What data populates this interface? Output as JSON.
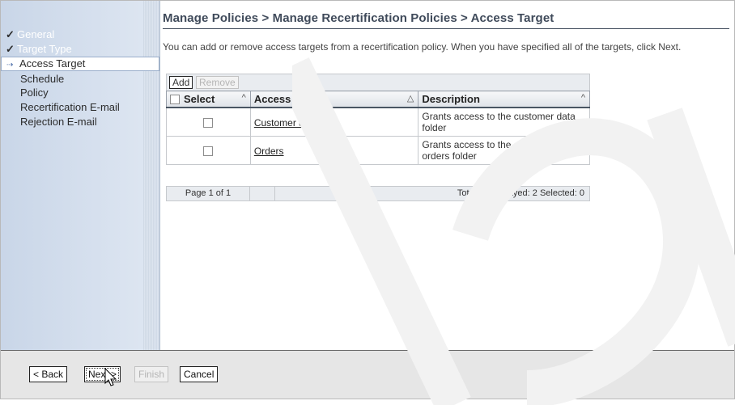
{
  "sidebar": {
    "items": [
      {
        "label": "General",
        "state": "done"
      },
      {
        "label": "Target Type",
        "state": "done"
      },
      {
        "label": "Access Target",
        "state": "current"
      },
      {
        "label": "Schedule",
        "state": "todo"
      },
      {
        "label": "Policy",
        "state": "todo"
      },
      {
        "label": "Recertification E-mail",
        "state": "todo"
      },
      {
        "label": "Rejection E-mail",
        "state": "todo"
      }
    ]
  },
  "main": {
    "title": "Manage Policies > Manage Recertification Policies > Access Target",
    "instructions": "You can add or remove access targets from a recertification policy. When you have specified all of the targets, click Next."
  },
  "toolbar": {
    "add_label": "Add",
    "remove_label": "Remove"
  },
  "table": {
    "columns": [
      "Select",
      "Access Name",
      "Description"
    ],
    "rows": [
      {
        "name": "Customer data",
        "description": "Grants access to the customer data folder"
      },
      {
        "name": "Orders",
        "description": "Grants access to the outstanding orders folder"
      }
    ],
    "page_label": "Page 1 of 1",
    "totals_label": "Total: 2  Displayed: 2  Selected: 0"
  },
  "wizard": {
    "back_label": "< Back",
    "next_label": "Next >",
    "finish_label": "Finish",
    "cancel_label": "Cancel"
  },
  "icons": {
    "done": "check-icon",
    "current": "arrow-icon"
  }
}
